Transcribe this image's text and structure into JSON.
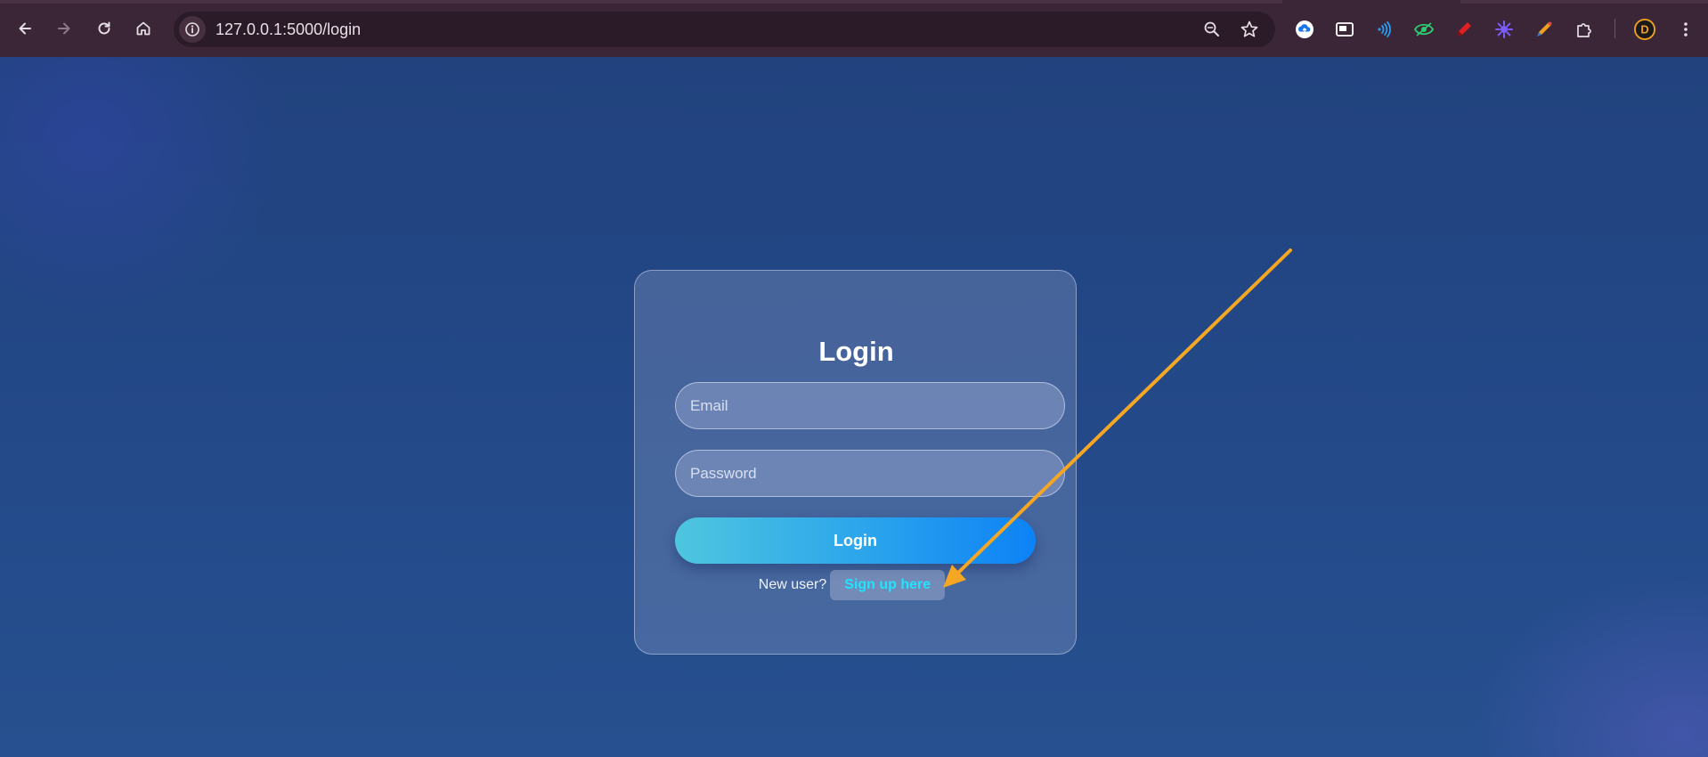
{
  "browser": {
    "url": "127.0.0.1:5000/login",
    "nav_icons": [
      "back-icon",
      "forward-icon",
      "reload-icon",
      "home-icon"
    ],
    "omnibox_icons": [
      "site-info-icon",
      "zoom-icon",
      "bookmark-star-icon"
    ],
    "extensions": [
      "cloud-upload-icon",
      "picture-in-picture-icon",
      "wireless-icon",
      "eye-icon",
      "marker-icon",
      "color-wheel-icon",
      "color-picker-icon",
      "puzzle-icon"
    ],
    "profile_initial": "D",
    "profile_icon": "profile-avatar-icon",
    "menu_icon": "kebab-menu-icon"
  },
  "login_card": {
    "title": "Login",
    "email_placeholder": "Email",
    "password_placeholder": "Password",
    "submit_label": "Login",
    "signup_prompt": "New user?",
    "signup_link": "Sign up here"
  },
  "annotation": {
    "type": "arrow",
    "color": "#f5a623",
    "points_to": "signup-link"
  }
}
